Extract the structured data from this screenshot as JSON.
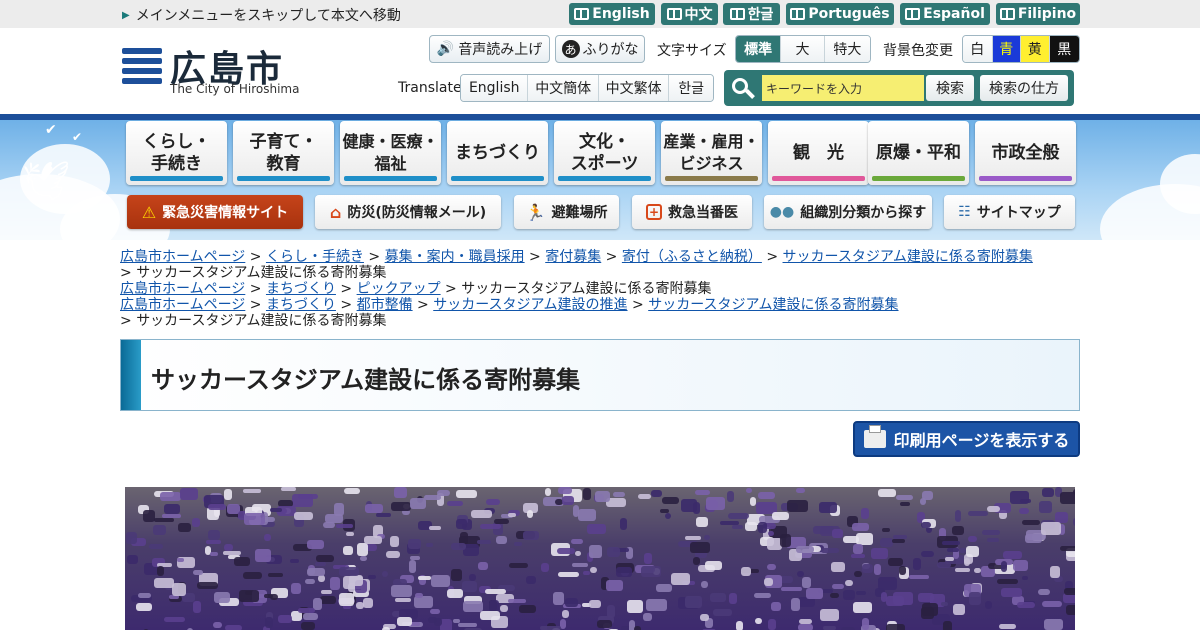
{
  "skip_link": "メインメニューをスキップして本文へ移動",
  "languages": [
    "English",
    "中文",
    "한글",
    "Português",
    "Español",
    "Filipino"
  ],
  "logo": {
    "ja": "広島市",
    "en": "The City of Hiroshima"
  },
  "tools": {
    "voice": "音声読み上げ",
    "furigana": "ふりがな",
    "text_size_label": "文字サイズ",
    "text_sizes": [
      "標準",
      "大",
      "特大"
    ],
    "bg_label": "背景色変更",
    "bg_colors": [
      "白",
      "青",
      "黄",
      "黒"
    ],
    "translate_label": "Translate",
    "translate_options": [
      "English",
      "中文簡体",
      "中文繁体",
      "한글"
    ]
  },
  "search": {
    "placeholder": "キーワードを入力",
    "button": "検索",
    "howto": "検索の仕方"
  },
  "nav": [
    {
      "label": "くらし・\n手続き",
      "color": "#1f8fc8"
    },
    {
      "label": "子育て・\n教育",
      "color": "#1f8fc8"
    },
    {
      "label": "健康・医療・\n福祉",
      "color": "#1f8fc8"
    },
    {
      "label": "まちづくり",
      "color": "#1f8fc8"
    },
    {
      "label": "文化・\nスポーツ",
      "color": "#1f8fc8"
    },
    {
      "label": "産業・雇用・\nビジネス",
      "color": "#8a7a4a"
    },
    {
      "label": "観　光",
      "color": "#e0589a"
    },
    {
      "label": "原爆・平和",
      "color": "#6aa83a"
    },
    {
      "label": "市政全般",
      "color": "#9a5ac8"
    }
  ],
  "subnav": {
    "emergency": "緊急災害情報サイト",
    "bousai": "防災(防災情報メール)",
    "evacuation": "避難場所",
    "kyukyu": "救急当番医",
    "org": "組織別分類から探す",
    "sitemap": "サイトマップ"
  },
  "breadcrumbs": [
    {
      "links": [
        "広島市ホームページ",
        "くらし・手続き",
        "募集・案内・職員採用",
        "寄付募集",
        "寄付（ふるさと納税）",
        "サッカースタジアム建設に係る寄附募集"
      ],
      "tail": ""
    },
    {
      "links": [],
      "tail": "サッカースタジアム建設に係る寄附募集"
    },
    {
      "links": [
        "広島市ホームページ",
        "まちづくり",
        "ピックアップ"
      ],
      "tail": "サッカースタジアム建設に係る寄附募集"
    },
    {
      "links": [
        "広島市ホームページ",
        "まちづくり",
        "都市整備",
        "サッカースタジアム建設の推進",
        "サッカースタジアム建設に係る寄附募集"
      ],
      "tail": ""
    },
    {
      "links": [],
      "tail": "サッカースタジアム建設に係る寄附募集"
    }
  ],
  "page_title": "サッカースタジアム建設に係る寄附募集",
  "print_button": "印刷用ページを表示する",
  "colors": {
    "teal": "#2f7774",
    "navy": "#1d4f9a",
    "print": "#1c54a6"
  }
}
